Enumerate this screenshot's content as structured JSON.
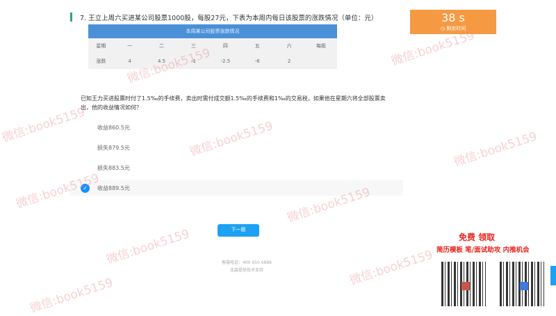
{
  "question": {
    "number": "7.",
    "title": "王立上周六买进某公司股票1000股，每股27元，下表为本周内每日该股票的涨跌情况（单位：元）",
    "table": {
      "caption": "本周某公司股票涨跌情况",
      "headers": [
        "星期",
        "一",
        "二",
        "三",
        "四",
        "五",
        "六",
        "每股"
      ],
      "row": [
        "涨跌",
        "4",
        "4.5",
        "-1",
        "-2.5",
        "-6",
        "2",
        ""
      ]
    },
    "text": "已知王力买进股票时付了1.5‰的手续费，卖出时需付成交额1.5‰的手续费和1‰的交易税，如果他在星期六将全部股票卖出，他的收益情况如何？",
    "options": [
      {
        "label": "收益860.5元",
        "selected": false
      },
      {
        "label": "损失879.5元",
        "selected": false
      },
      {
        "label": "损失883.5元",
        "selected": false
      },
      {
        "label": "收益889.5元",
        "selected": true
      }
    ]
  },
  "timer": {
    "value": "38 s",
    "label": "剩余时间"
  },
  "next_label": "下一题",
  "footer": {
    "phone": "客服电话：400 650 6886",
    "support": "北森提供技术支持"
  },
  "promo": {
    "title": "免费 领取",
    "subtitle": "简历模板  笔/面试助攻  内推机会"
  },
  "watermark": "微信:book5159",
  "colors": {
    "accent": "#1da1f2",
    "timer": "#f59a42",
    "promo": "#e8251e"
  }
}
